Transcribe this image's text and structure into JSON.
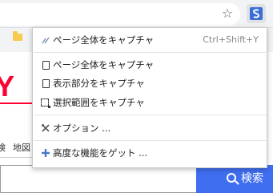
{
  "browser": {
    "star_glyph": "☆"
  },
  "menu": {
    "items": [
      {
        "label": "ページ全体をキャプチャ",
        "shortcut": "Ctrl+Shift+Y",
        "icon": "fullpage-capture-icon"
      },
      {
        "label": "ページ全体をキャプチャ",
        "icon": "page-icon"
      },
      {
        "label": "表示部分をキャプチャ",
        "icon": "visible-part-icon"
      },
      {
        "label": "選択範囲をキャプチャ",
        "icon": "selection-icon"
      },
      {
        "label": "オプション ...",
        "icon": "tools-icon"
      },
      {
        "label": "高度な機能をゲット ...",
        "icon": "plus-icon"
      }
    ]
  },
  "page": {
    "nav_tabs": [
      "検",
      "地図"
    ],
    "search_button_label": "検索"
  },
  "colors": {
    "logo_red": "#ff0033",
    "search_blue": "#3f6ef0",
    "extension_badge": "#3b6fd6"
  }
}
